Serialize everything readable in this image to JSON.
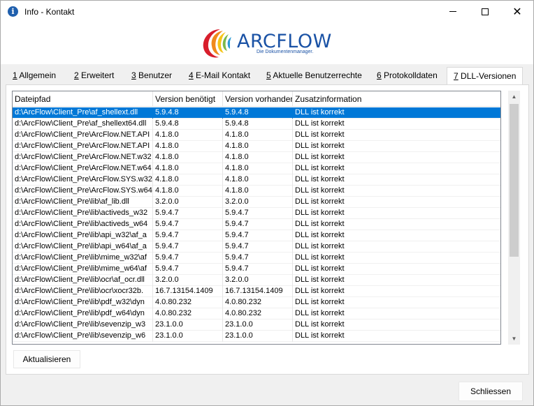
{
  "window": {
    "title": "Info - Kontakt",
    "icon": "info-icon"
  },
  "logo": {
    "word": "ARCFLOW",
    "tagline": "Die Dokumentenmanager.",
    "colors": {
      "brand": "#1a52a5"
    }
  },
  "tabs": [
    {
      "key": "1",
      "label": " Allgemein",
      "active": false
    },
    {
      "key": "2",
      "label": " Erweitert",
      "active": false
    },
    {
      "key": "3",
      "label": " Benutzer",
      "active": false
    },
    {
      "key": "4",
      "label": " E-Mail Kontakt",
      "active": false
    },
    {
      "key": "5",
      "label": " Aktuelle Benutzerrechte",
      "active": false
    },
    {
      "key": "6",
      "label": " Protokolldaten",
      "active": false
    },
    {
      "key": "7",
      "label": " DLL-Versionen",
      "active": true
    }
  ],
  "grid": {
    "columns": [
      "Dateipfad",
      "Version benötigt",
      "Version vorhanden",
      "Zusatzinformation"
    ],
    "rows": [
      [
        "d:\\ArcFlow\\Client_Pre\\af_shellext.dll",
        "5.9.4.8",
        "5.9.4.8",
        "DLL ist korrekt"
      ],
      [
        "d:\\ArcFlow\\Client_Pre\\af_shellext64.dll",
        "5.9.4.8",
        "5.9.4.8",
        "DLL ist korrekt"
      ],
      [
        "d:\\ArcFlow\\Client_Pre\\ArcFlow.NET.API",
        "4.1.8.0",
        "4.1.8.0",
        "DLL ist korrekt"
      ],
      [
        "d:\\ArcFlow\\Client_Pre\\ArcFlow.NET.API",
        "4.1.8.0",
        "4.1.8.0",
        "DLL ist korrekt"
      ],
      [
        "d:\\ArcFlow\\Client_Pre\\ArcFlow.NET.w32",
        "4.1.8.0",
        "4.1.8.0",
        "DLL ist korrekt"
      ],
      [
        "d:\\ArcFlow\\Client_Pre\\ArcFlow.NET.w64",
        "4.1.8.0",
        "4.1.8.0",
        "DLL ist korrekt"
      ],
      [
        "d:\\ArcFlow\\Client_Pre\\ArcFlow.SYS.w32",
        "4.1.8.0",
        "4.1.8.0",
        "DLL ist korrekt"
      ],
      [
        "d:\\ArcFlow\\Client_Pre\\ArcFlow.SYS.w64",
        "4.1.8.0",
        "4.1.8.0",
        "DLL ist korrekt"
      ],
      [
        "d:\\ArcFlow\\Client_Pre\\lib\\af_lib.dll",
        "3.2.0.0",
        "3.2.0.0",
        "DLL ist korrekt"
      ],
      [
        "d:\\ArcFlow\\Client_Pre\\lib\\activeds_w32",
        "5.9.4.7",
        "5.9.4.7",
        "DLL ist korrekt"
      ],
      [
        "d:\\ArcFlow\\Client_Pre\\lib\\activeds_w64",
        "5.9.4.7",
        "5.9.4.7",
        "DLL ist korrekt"
      ],
      [
        "d:\\ArcFlow\\Client_Pre\\lib\\api_w32\\af_a",
        "5.9.4.7",
        "5.9.4.7",
        "DLL ist korrekt"
      ],
      [
        "d:\\ArcFlow\\Client_Pre\\lib\\api_w64\\af_a",
        "5.9.4.7",
        "5.9.4.7",
        "DLL ist korrekt"
      ],
      [
        "d:\\ArcFlow\\Client_Pre\\lib\\mime_w32\\af",
        "5.9.4.7",
        "5.9.4.7",
        "DLL ist korrekt"
      ],
      [
        "d:\\ArcFlow\\Client_Pre\\lib\\mime_w64\\af",
        "5.9.4.7",
        "5.9.4.7",
        "DLL ist korrekt"
      ],
      [
        "d:\\ArcFlow\\Client_Pre\\lib\\ocr\\af_ocr.dll",
        "3.2.0.0",
        "3.2.0.0",
        "DLL ist korrekt"
      ],
      [
        "d:\\ArcFlow\\Client_Pre\\lib\\ocr\\xocr32b.",
        "16.7.13154.1409",
        "16.7.13154.1409",
        "DLL ist korrekt"
      ],
      [
        "d:\\ArcFlow\\Client_Pre\\lib\\pdf_w32\\dyn",
        "4.0.80.232",
        "4.0.80.232",
        "DLL ist korrekt"
      ],
      [
        "d:\\ArcFlow\\Client_Pre\\lib\\pdf_w64\\dyn",
        "4.0.80.232",
        "4.0.80.232",
        "DLL ist korrekt"
      ],
      [
        "d:\\ArcFlow\\Client_Pre\\lib\\sevenzip_w3",
        "23.1.0.0",
        "23.1.0.0",
        "DLL ist korrekt"
      ],
      [
        "d:\\ArcFlow\\Client_Pre\\lib\\sevenzip_w6",
        "23.1.0.0",
        "23.1.0.0",
        "DLL ist korrekt"
      ]
    ],
    "selected_row": 0,
    "selection_color": "#0078d7"
  },
  "buttons": {
    "refresh_label": "Aktualisieren",
    "close_label": "Schliessen"
  }
}
